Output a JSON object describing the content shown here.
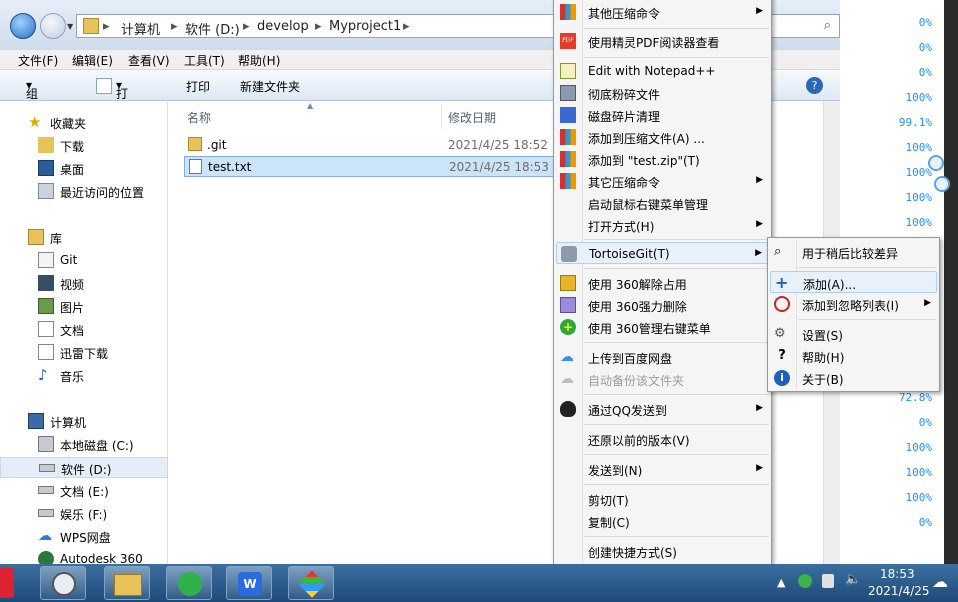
{
  "explorer": {
    "breadcrumb": [
      "计算机",
      "软件 (D:)",
      "develop",
      "Myproject1"
    ],
    "menubar": [
      "文件(F)",
      "编辑(E)",
      "查看(V)",
      "工具(T)",
      "帮助(H)"
    ],
    "toolbar": [
      "组织",
      "打开",
      "打印",
      "新建文件夹"
    ],
    "columns": {
      "name": "名称",
      "date": "修改日期"
    },
    "files": [
      {
        "name": ".git",
        "date": "2021/4/25 18:52",
        "icon": "folder-icon"
      },
      {
        "name": "test.txt",
        "date": "2021/4/25 18:53",
        "icon": "text-file-icon",
        "selected": true
      }
    ],
    "nav": {
      "favorites": "收藏夹",
      "fav_items": [
        "下载",
        "桌面",
        "最近访问的位置"
      ],
      "libraries": "库",
      "lib_items": [
        "Git",
        "视频",
        "图片",
        "文档",
        "迅雷下载",
        "音乐"
      ],
      "computer": "计算机",
      "drives": [
        "本地磁盘 (C:)",
        "软件 (D:)",
        "文档 (E:)",
        "娱乐 (F:)",
        "WPS网盘",
        "Autodesk 360"
      ]
    }
  },
  "right_strip": {
    "percentages": [
      "0%",
      "0%",
      "0%",
      "100%",
      "99.1%",
      "100%",
      "100%",
      "100%",
      "100%",
      "72.8%",
      "0%",
      "100%",
      "100%",
      "100%",
      "0%"
    ]
  },
  "context_menu": {
    "items": [
      {
        "label": "其他压缩命令",
        "icon": "archive-icon",
        "submenu": true
      },
      {
        "label": "使用精灵PDF阅读器查看",
        "icon": "pdf-icon"
      },
      {
        "label": "Edit with Notepad++",
        "icon": "notepad-icon"
      },
      {
        "label": "彻底粉碎文件",
        "icon": "shredder-icon"
      },
      {
        "label": "磁盘碎片清理",
        "icon": "disk-clean-icon"
      },
      {
        "label": "添加到压缩文件(A) ...",
        "icon": "archive-icon"
      },
      {
        "label": "添加到 \"test.zip\"(T)",
        "icon": "archive-icon"
      },
      {
        "label": "其它压缩命令",
        "icon": "archive-icon",
        "submenu": true
      },
      {
        "label": "启动鼠标右键菜单管理",
        "icon": ""
      },
      {
        "label": "打开方式(H)",
        "icon": "",
        "submenu": true
      },
      {
        "label": "TortoiseGit(T)",
        "icon": "tortoisegit-icon",
        "submenu": true,
        "highlighted": true
      },
      {
        "label": "使用 360解除占用",
        "icon": "360-unlock-icon"
      },
      {
        "label": "使用 360强力删除",
        "icon": "360-delete-icon"
      },
      {
        "label": "使用 360管理右键菜单",
        "icon": "360-menu-icon"
      },
      {
        "label": "上传到百度网盘",
        "icon": "baidu-cloud-icon"
      },
      {
        "label": "自动备份该文件夹",
        "icon": "baidu-backup-icon",
        "disabled": true
      },
      {
        "label": "通过QQ发送到",
        "icon": "qq-icon",
        "submenu": true
      },
      {
        "label": "还原以前的版本(V)",
        "icon": ""
      },
      {
        "label": "发送到(N)",
        "icon": "",
        "submenu": true
      },
      {
        "label": "剪切(T)",
        "icon": ""
      },
      {
        "label": "复制(C)",
        "icon": ""
      },
      {
        "label": "创建快捷方式(S)",
        "icon": ""
      }
    ]
  },
  "tortoise_submenu": {
    "items": [
      {
        "label": "用于稍后比较差异",
        "icon": "magnifier-icon"
      },
      {
        "label": "添加(A)...",
        "icon": "plus-icon",
        "highlighted": true
      },
      {
        "label": "添加到忽略列表(I)",
        "icon": "ignore-icon",
        "submenu": true
      },
      {
        "label": "设置(S)",
        "icon": "settings-icon"
      },
      {
        "label": "帮助(H)",
        "icon": "help-icon"
      },
      {
        "label": "关于(B)",
        "icon": "info-icon"
      }
    ]
  },
  "taskbar": {
    "time": "18:53",
    "date": "2021/4/25"
  }
}
